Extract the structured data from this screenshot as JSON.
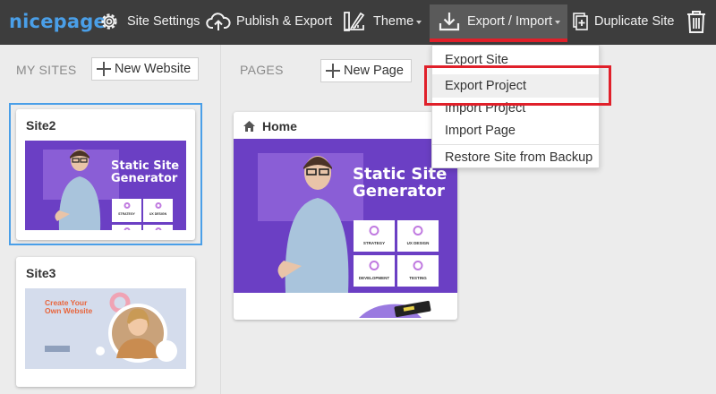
{
  "topbar": {
    "logo": "nicepage",
    "site_settings": "Site Settings",
    "publish_export": "Publish & Export",
    "theme": "Theme",
    "export_import": "Export / Import",
    "duplicate_site": "Duplicate Site",
    "delete_icon": "trash-icon"
  },
  "sites": {
    "title": "MY SITES",
    "new_button": "New Website",
    "items": [
      {
        "name": "Site2",
        "selected": true,
        "hero_title": "Static Site Generator",
        "tiles": [
          "STRATEGY",
          "UX DESIGN",
          "",
          ""
        ]
      },
      {
        "name": "Site3",
        "selected": false,
        "hero_title": "Create Your Own Website"
      }
    ]
  },
  "pages": {
    "title": "PAGES",
    "new_button": "New Page",
    "items": [
      {
        "name": "Home",
        "hero_title": "Static Site Generator",
        "tiles": [
          "STRATEGY",
          "UX DESIGN",
          "DEVELOPMENT",
          "TESTING"
        ]
      }
    ]
  },
  "dropdown": {
    "items": [
      "Export Site",
      "Export Project",
      "Import Project",
      "Import Page",
      "Restore Site from Backup"
    ],
    "highlighted": "Export Project"
  },
  "colors": {
    "topbar": "#3d3d3d",
    "accent_blue": "#4a9fe8",
    "highlight_red": "#e0202a",
    "hero_purple": "#6b3fc4"
  }
}
